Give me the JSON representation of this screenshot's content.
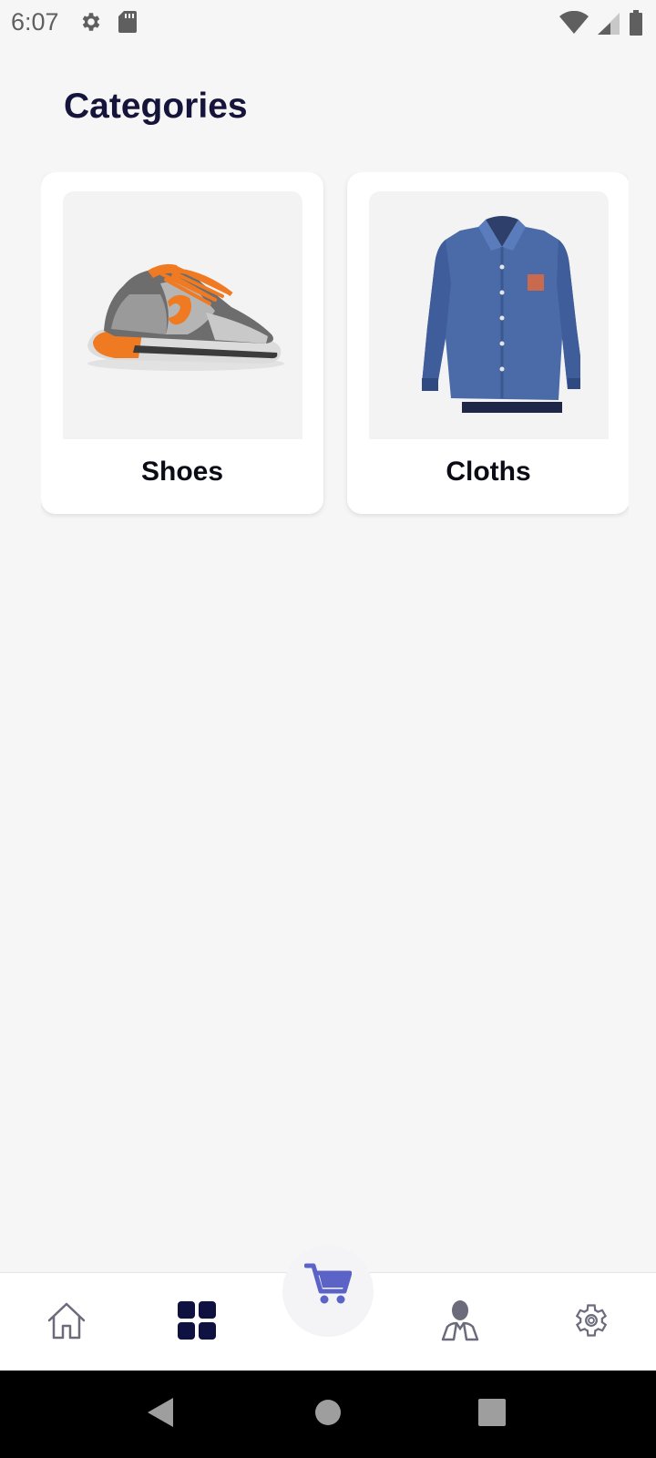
{
  "status_bar": {
    "time": "6:07",
    "icons": [
      "settings-gear-icon",
      "sd-card-icon",
      "wifi-icon",
      "cell-signal-icon",
      "battery-icon"
    ]
  },
  "page": {
    "title": "Categories"
  },
  "categories": [
    {
      "label": "Shoes",
      "image": "orange-gray-running-shoe"
    },
    {
      "label": "Cloths",
      "image": "blue-button-up-shirt"
    }
  ],
  "bottom_nav": {
    "items": [
      "home-icon",
      "categories-grid-icon",
      "cart-icon",
      "profile-icon",
      "settings-gear-icon"
    ],
    "active": "categories-grid-icon",
    "colors": {
      "active": "#0f1240",
      "inactive": "#6b6b7b",
      "cart": "#5c63c7"
    }
  },
  "system_nav": {
    "buttons": [
      "back-icon",
      "home-circle-icon",
      "recents-square-icon"
    ]
  }
}
